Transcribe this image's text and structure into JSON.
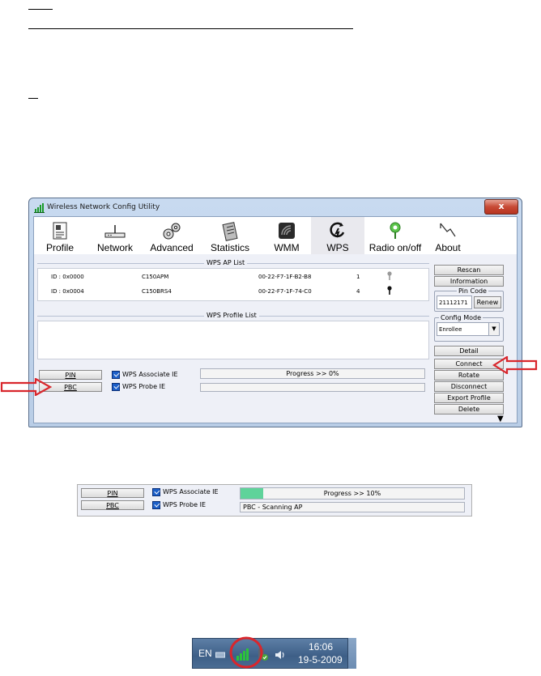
{
  "window": {
    "title": "Wireless Network Config Utility",
    "close_label": "x"
  },
  "toolbar": [
    {
      "label": "Profile",
      "icon": "profile-icon"
    },
    {
      "label": "Network",
      "icon": "network-icon"
    },
    {
      "label": "Advanced",
      "icon": "advanced-gears-icon"
    },
    {
      "label": "Statistics",
      "icon": "statistics-icon"
    },
    {
      "label": "WMM",
      "icon": "wmm-icon"
    },
    {
      "label": "WPS",
      "icon": "wps-icon",
      "active": true
    },
    {
      "label": "Radio on/off",
      "icon": "radio-icon"
    },
    {
      "label": "About",
      "icon": "about-icon"
    }
  ],
  "wps_ap_list": {
    "title": "WPS AP List",
    "rows": [
      {
        "id": "ID : 0x0000",
        "ssid": "C150APM",
        "bssid": "00-22-F7-1F-B2-B8",
        "channel": "1",
        "icon": "key-gray-icon"
      },
      {
        "id": "ID : 0x0004",
        "ssid": "C150BRS4",
        "bssid": "00-22-F7-1F-74-C0",
        "channel": "4",
        "icon": "key-black-icon"
      }
    ]
  },
  "wps_profile_list": {
    "title": "WPS Profile List"
  },
  "side_buttons": {
    "rescan": "Rescan",
    "information": "Information",
    "pin_code_legend": "Pin Code",
    "pin_code_value": "21112171",
    "renew": "Renew",
    "config_mode_legend": "Config Mode",
    "config_mode_value": "Enrollee",
    "detail": "Detail",
    "connect": "Connect",
    "rotate": "Rotate",
    "disconnect": "Disconnect",
    "export_profile": "Export Profile",
    "delete": "Delete"
  },
  "bottom": {
    "pin": "PIN",
    "pbc": "PBC",
    "wps_associate_ie": "WPS Associate IE",
    "wps_probe_ie": "WPS Probe IE",
    "progress_text": "Progress >> 0%",
    "progress_value": 0,
    "status_text": ""
  },
  "panel2": {
    "pin": "PIN",
    "pbc": "PBC",
    "wps_associate_ie": "WPS Associate IE",
    "wps_probe_ie": "WPS Probe IE",
    "progress_text": "Progress >> 10%",
    "progress_value": 10,
    "status_text": "PBC - Scanning AP"
  },
  "tray": {
    "language": "EN",
    "time": "16:06",
    "date": "19-5-2009"
  },
  "colors": {
    "accent_red": "#d9262c",
    "progress_green": "#5fd39a"
  }
}
